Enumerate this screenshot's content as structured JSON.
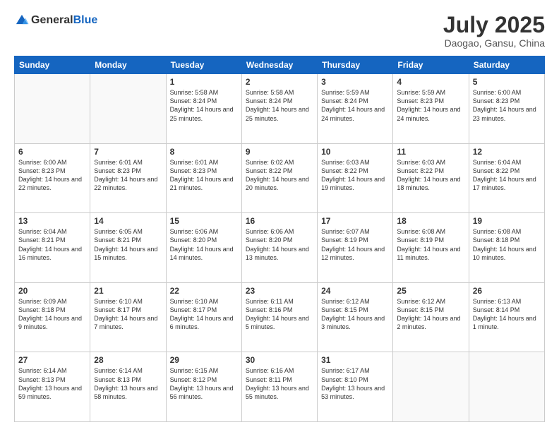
{
  "logo": {
    "general": "General",
    "blue": "Blue"
  },
  "header": {
    "title": "July 2025",
    "subtitle": "Daogao, Gansu, China"
  },
  "days_of_week": [
    "Sunday",
    "Monday",
    "Tuesday",
    "Wednesday",
    "Thursday",
    "Friday",
    "Saturday"
  ],
  "weeks": [
    [
      {
        "day": "",
        "empty": true
      },
      {
        "day": "",
        "empty": true
      },
      {
        "day": "1",
        "sunrise": "5:58 AM",
        "sunset": "8:24 PM",
        "daylight": "14 hours and 25 minutes."
      },
      {
        "day": "2",
        "sunrise": "5:58 AM",
        "sunset": "8:24 PM",
        "daylight": "14 hours and 25 minutes."
      },
      {
        "day": "3",
        "sunrise": "5:59 AM",
        "sunset": "8:24 PM",
        "daylight": "14 hours and 24 minutes."
      },
      {
        "day": "4",
        "sunrise": "5:59 AM",
        "sunset": "8:23 PM",
        "daylight": "14 hours and 24 minutes."
      },
      {
        "day": "5",
        "sunrise": "6:00 AM",
        "sunset": "8:23 PM",
        "daylight": "14 hours and 23 minutes."
      }
    ],
    [
      {
        "day": "6",
        "sunrise": "6:00 AM",
        "sunset": "8:23 PM",
        "daylight": "14 hours and 22 minutes."
      },
      {
        "day": "7",
        "sunrise": "6:01 AM",
        "sunset": "8:23 PM",
        "daylight": "14 hours and 22 minutes."
      },
      {
        "day": "8",
        "sunrise": "6:01 AM",
        "sunset": "8:23 PM",
        "daylight": "14 hours and 21 minutes."
      },
      {
        "day": "9",
        "sunrise": "6:02 AM",
        "sunset": "8:22 PM",
        "daylight": "14 hours and 20 minutes."
      },
      {
        "day": "10",
        "sunrise": "6:03 AM",
        "sunset": "8:22 PM",
        "daylight": "14 hours and 19 minutes."
      },
      {
        "day": "11",
        "sunrise": "6:03 AM",
        "sunset": "8:22 PM",
        "daylight": "14 hours and 18 minutes."
      },
      {
        "day": "12",
        "sunrise": "6:04 AM",
        "sunset": "8:22 PM",
        "daylight": "14 hours and 17 minutes."
      }
    ],
    [
      {
        "day": "13",
        "sunrise": "6:04 AM",
        "sunset": "8:21 PM",
        "daylight": "14 hours and 16 minutes."
      },
      {
        "day": "14",
        "sunrise": "6:05 AM",
        "sunset": "8:21 PM",
        "daylight": "14 hours and 15 minutes."
      },
      {
        "day": "15",
        "sunrise": "6:06 AM",
        "sunset": "8:20 PM",
        "daylight": "14 hours and 14 minutes."
      },
      {
        "day": "16",
        "sunrise": "6:06 AM",
        "sunset": "8:20 PM",
        "daylight": "14 hours and 13 minutes."
      },
      {
        "day": "17",
        "sunrise": "6:07 AM",
        "sunset": "8:19 PM",
        "daylight": "14 hours and 12 minutes."
      },
      {
        "day": "18",
        "sunrise": "6:08 AM",
        "sunset": "8:19 PM",
        "daylight": "14 hours and 11 minutes."
      },
      {
        "day": "19",
        "sunrise": "6:08 AM",
        "sunset": "8:18 PM",
        "daylight": "14 hours and 10 minutes."
      }
    ],
    [
      {
        "day": "20",
        "sunrise": "6:09 AM",
        "sunset": "8:18 PM",
        "daylight": "14 hours and 9 minutes."
      },
      {
        "day": "21",
        "sunrise": "6:10 AM",
        "sunset": "8:17 PM",
        "daylight": "14 hours and 7 minutes."
      },
      {
        "day": "22",
        "sunrise": "6:10 AM",
        "sunset": "8:17 PM",
        "daylight": "14 hours and 6 minutes."
      },
      {
        "day": "23",
        "sunrise": "6:11 AM",
        "sunset": "8:16 PM",
        "daylight": "14 hours and 5 minutes."
      },
      {
        "day": "24",
        "sunrise": "6:12 AM",
        "sunset": "8:15 PM",
        "daylight": "14 hours and 3 minutes."
      },
      {
        "day": "25",
        "sunrise": "6:12 AM",
        "sunset": "8:15 PM",
        "daylight": "14 hours and 2 minutes."
      },
      {
        "day": "26",
        "sunrise": "6:13 AM",
        "sunset": "8:14 PM",
        "daylight": "14 hours and 1 minute."
      }
    ],
    [
      {
        "day": "27",
        "sunrise": "6:14 AM",
        "sunset": "8:13 PM",
        "daylight": "13 hours and 59 minutes."
      },
      {
        "day": "28",
        "sunrise": "6:14 AM",
        "sunset": "8:13 PM",
        "daylight": "13 hours and 58 minutes."
      },
      {
        "day": "29",
        "sunrise": "6:15 AM",
        "sunset": "8:12 PM",
        "daylight": "13 hours and 56 minutes."
      },
      {
        "day": "30",
        "sunrise": "6:16 AM",
        "sunset": "8:11 PM",
        "daylight": "13 hours and 55 minutes."
      },
      {
        "day": "31",
        "sunrise": "6:17 AM",
        "sunset": "8:10 PM",
        "daylight": "13 hours and 53 minutes."
      },
      {
        "day": "",
        "empty": true
      },
      {
        "day": "",
        "empty": true
      }
    ]
  ]
}
